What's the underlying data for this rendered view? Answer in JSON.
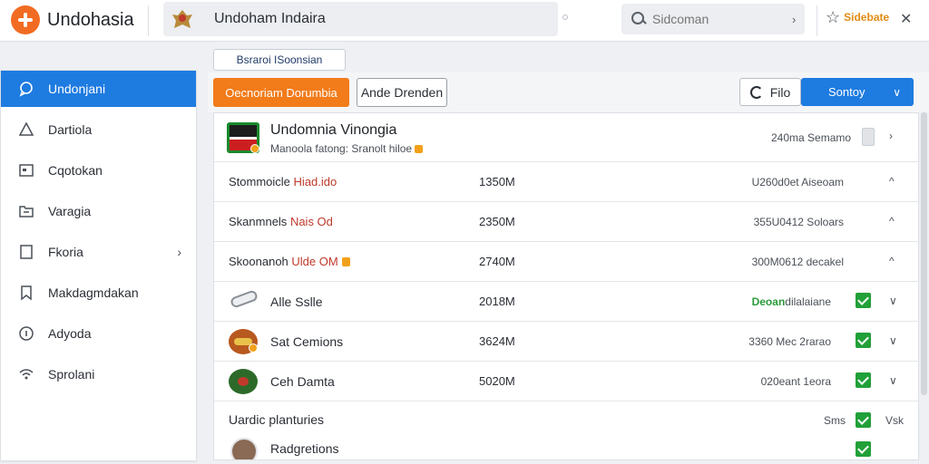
{
  "app": {
    "title": "Undohasia"
  },
  "window": {
    "title": "Undoham Indaira"
  },
  "search": {
    "placeholder": "Sidcoman"
  },
  "header_action": {
    "label": "Sidebate"
  },
  "sidebar": {
    "items": [
      {
        "label": "Undonjani",
        "icon": "chat-icon",
        "active": true
      },
      {
        "label": "Dartiola",
        "icon": "triangle-icon"
      },
      {
        "label": "Cqotokan",
        "icon": "image-icon"
      },
      {
        "label": "Varagia",
        "icon": "folder-icon"
      },
      {
        "label": "Fkoria",
        "icon": "document-icon"
      },
      {
        "label": "Makdagmdakan",
        "icon": "bookmark-icon"
      },
      {
        "label": "Adyoda",
        "icon": "info-icon"
      },
      {
        "label": "Sprolani",
        "icon": "wifi-icon"
      }
    ]
  },
  "main": {
    "tab_label": "Bsraroi ISoonsian",
    "primary_button": "Oecnoriam Dorumbia",
    "secondary_button": "Ande Drenden",
    "filter_button": "Filo",
    "sort_button": "Sontoy"
  },
  "header_row": {
    "title": "Undomnia Vinongia",
    "subtitle": "Manoola fatong: Sranolt hiloe",
    "meta": "240ma Semamo"
  },
  "rows": [
    {
      "name": "Stommoicle",
      "highlight": "Hiad.ido",
      "size": "1350M",
      "meta": "U260d0et Aiseoam"
    },
    {
      "name": "Skanmnels",
      "highlight": "Nais Od",
      "size": "2350M",
      "meta": "355U0412 Soloars"
    },
    {
      "name": "Skoonanoh",
      "highlight": "Ulde OM",
      "size": "2740M",
      "meta": "300M0612 decakel"
    }
  ],
  "items": [
    {
      "name": "Alle Sslle",
      "size": "2018M",
      "meta_highlight": "Deoan",
      "meta": "dilalaiane",
      "icon": "pill-icon"
    },
    {
      "name": "Sat Cemions",
      "size": "3624M",
      "meta": "3360 Mec 2rarao",
      "icon": "food-icon"
    },
    {
      "name": "Ceh Damta",
      "size": "5020M",
      "meta": "020eant 1eora",
      "icon": "herb-icon"
    }
  ],
  "footer": {
    "title": "Uardic planturies",
    "meta": "Sms",
    "mini": "Vsk",
    "name": "Radgretions"
  },
  "colors": {
    "accent_blue": "#1e7be0",
    "accent_orange": "#f27b1a",
    "check_green": "#21a038",
    "highlight_red": "#c0392b"
  }
}
